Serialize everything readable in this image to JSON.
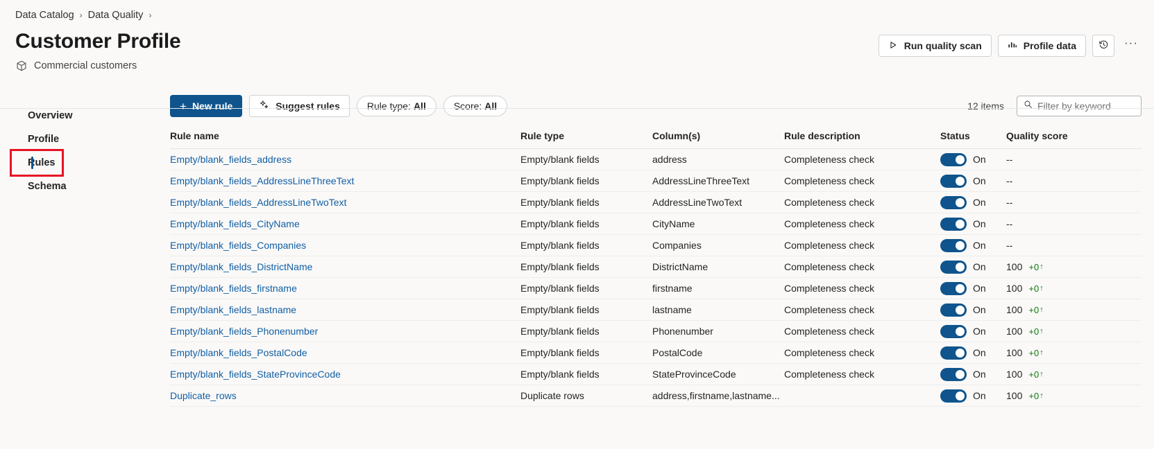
{
  "breadcrumb": {
    "items": [
      "Data Catalog",
      "Data Quality"
    ],
    "separator": "›"
  },
  "header": {
    "title": "Customer Profile",
    "subtitle": "Commercial customers",
    "subtitle_icon": "cube-icon",
    "actions": {
      "run_scan": "Run quality scan",
      "run_scan_icon": "play-triangle-icon",
      "profile_data": "Profile data",
      "profile_data_icon": "bar-chart-icon",
      "history_icon": "history-clock-icon",
      "more": "···"
    }
  },
  "sidebar": {
    "items": [
      {
        "label": "Overview",
        "selected": false
      },
      {
        "label": "Profile",
        "selected": false
      },
      {
        "label": "Rules",
        "selected": true,
        "annotated": true
      },
      {
        "label": "Schema",
        "selected": false
      }
    ]
  },
  "toolbar": {
    "new_rule": "New rule",
    "new_rule_icon": "plus-icon",
    "suggest_rules": "Suggest rules",
    "suggest_rules_icon": "sparkle-icon",
    "rule_type_filter_label": "Rule type:",
    "rule_type_filter_value": "All",
    "score_filter_label": "Score:",
    "score_filter_value": "All",
    "item_count": "12 items",
    "search_icon": "search-icon",
    "search_placeholder": "Filter by keyword",
    "search_value": ""
  },
  "table": {
    "columns": [
      "Rule name",
      "Rule type",
      "Column(s)",
      "Rule description",
      "Status",
      "Quality score"
    ],
    "status_on_label": "On",
    "rows": [
      {
        "name": "Empty/blank_fields_address",
        "type": "Empty/blank fields",
        "columns": "address",
        "description": "Completeness check",
        "status": "On",
        "score": "--",
        "delta": ""
      },
      {
        "name": "Empty/blank_fields_AddressLineThreeText",
        "type": "Empty/blank fields",
        "columns": "AddressLineThreeText",
        "description": "Completeness check",
        "status": "On",
        "score": "--",
        "delta": ""
      },
      {
        "name": "Empty/blank_fields_AddressLineTwoText",
        "type": "Empty/blank fields",
        "columns": "AddressLineTwoText",
        "description": "Completeness check",
        "status": "On",
        "score": "--",
        "delta": ""
      },
      {
        "name": "Empty/blank_fields_CityName",
        "type": "Empty/blank fields",
        "columns": "CityName",
        "description": "Completeness check",
        "status": "On",
        "score": "--",
        "delta": ""
      },
      {
        "name": "Empty/blank_fields_Companies",
        "type": "Empty/blank fields",
        "columns": "Companies",
        "description": "Completeness check",
        "status": "On",
        "score": "--",
        "delta": ""
      },
      {
        "name": "Empty/blank_fields_DistrictName",
        "type": "Empty/blank fields",
        "columns": "DistrictName",
        "description": "Completeness check",
        "status": "On",
        "score": "100",
        "delta": "+0"
      },
      {
        "name": "Empty/blank_fields_firstname",
        "type": "Empty/blank fields",
        "columns": "firstname",
        "description": "Completeness check",
        "status": "On",
        "score": "100",
        "delta": "+0"
      },
      {
        "name": "Empty/blank_fields_lastname",
        "type": "Empty/blank fields",
        "columns": "lastname",
        "description": "Completeness check",
        "status": "On",
        "score": "100",
        "delta": "+0"
      },
      {
        "name": "Empty/blank_fields_Phonenumber",
        "type": "Empty/blank fields",
        "columns": "Phonenumber",
        "description": "Completeness check",
        "status": "On",
        "score": "100",
        "delta": "+0"
      },
      {
        "name": "Empty/blank_fields_PostalCode",
        "type": "Empty/blank fields",
        "columns": "PostalCode",
        "description": "Completeness check",
        "status": "On",
        "score": "100",
        "delta": "+0"
      },
      {
        "name": "Empty/blank_fields_StateProvinceCode",
        "type": "Empty/blank fields",
        "columns": "StateProvinceCode",
        "description": "Completeness check",
        "status": "On",
        "score": "100",
        "delta": "+0"
      },
      {
        "name": "Duplicate_rows",
        "type": "Duplicate rows",
        "columns": "address,firstname,lastname...",
        "description": "",
        "status": "On",
        "score": "100",
        "delta": "+0"
      }
    ]
  },
  "colors": {
    "accent": "#0f548c",
    "link": "#115ea3",
    "annotation": "#e81123",
    "delta_positive": "#0e7a0b"
  }
}
